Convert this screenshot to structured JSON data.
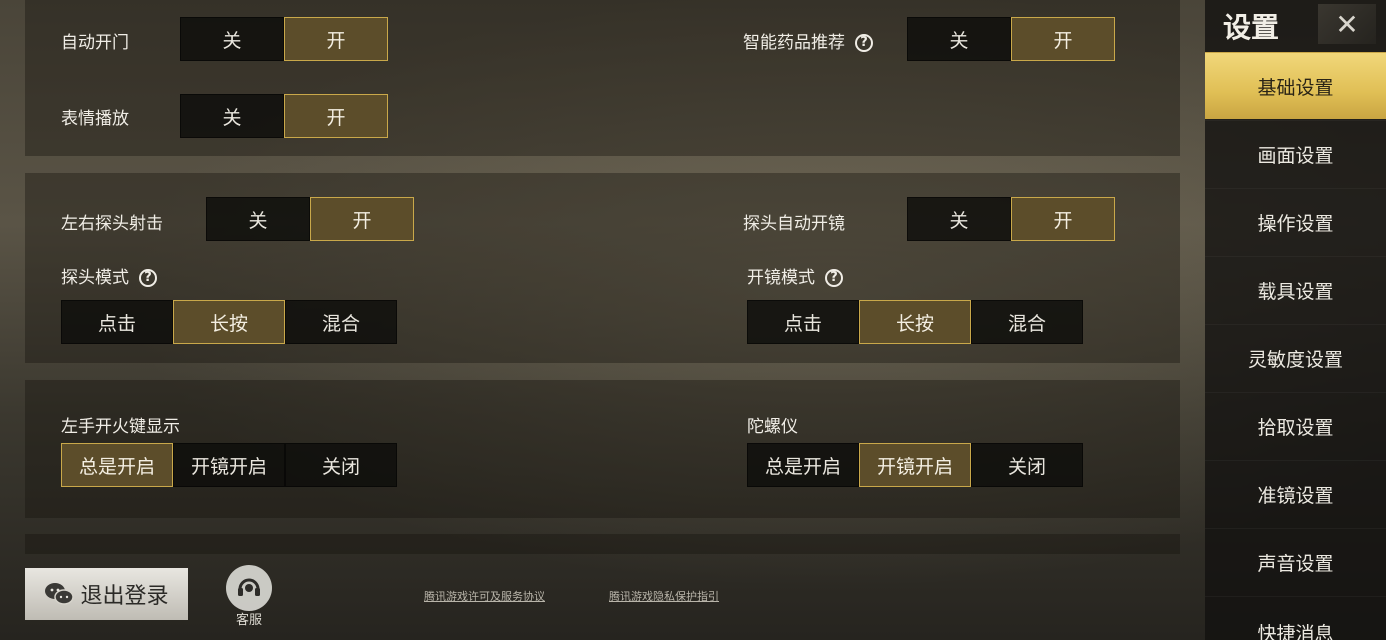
{
  "sections": {
    "s1": {
      "auto_door": {
        "label": "自动开门",
        "options": [
          "关",
          "开"
        ],
        "selected": 1
      },
      "smart_med": {
        "label": "智能药品推荐",
        "options": [
          "关",
          "开"
        ],
        "selected": 1
      },
      "emote": {
        "label": "表情播放",
        "options": [
          "关",
          "开"
        ],
        "selected": 1
      }
    },
    "s2": {
      "peek_fire": {
        "label": "左右探头射击",
        "options": [
          "关",
          "开"
        ],
        "selected": 1
      },
      "peek_scope": {
        "label": "探头自动开镜",
        "options": [
          "关",
          "开"
        ],
        "selected": 1
      },
      "peek_mode": {
        "label": "探头模式",
        "options": [
          "点击",
          "长按",
          "混合"
        ],
        "selected": 1
      },
      "scope_mode": {
        "label": "开镜模式",
        "options": [
          "点击",
          "长按",
          "混合"
        ],
        "selected": 1
      }
    },
    "s3": {
      "left_fire": {
        "label": "左手开火键显示",
        "options": [
          "总是开启",
          "开镜开启",
          "关闭"
        ],
        "selected": 0
      },
      "gyro": {
        "label": "陀螺仪",
        "options": [
          "总是开启",
          "开镜开启",
          "关闭"
        ],
        "selected": 1
      }
    }
  },
  "sidebar": {
    "title": "设置",
    "close_icon": "close-icon",
    "items": [
      "基础设置",
      "画面设置",
      "操作设置",
      "载具设置",
      "灵敏度设置",
      "拾取设置",
      "准镜设置",
      "声音设置",
      "快捷消息"
    ],
    "active_index": 0
  },
  "bottom": {
    "logout_label": "退出登录",
    "service_label": "客服",
    "license_link": "腾讯游戏许可及服务协议",
    "privacy_link": "腾讯游戏隐私保护指引"
  },
  "colors": {
    "accent": "#c9a84a",
    "active_fill": "#5c4d2a",
    "sidebar_active": "#e0bf55"
  }
}
